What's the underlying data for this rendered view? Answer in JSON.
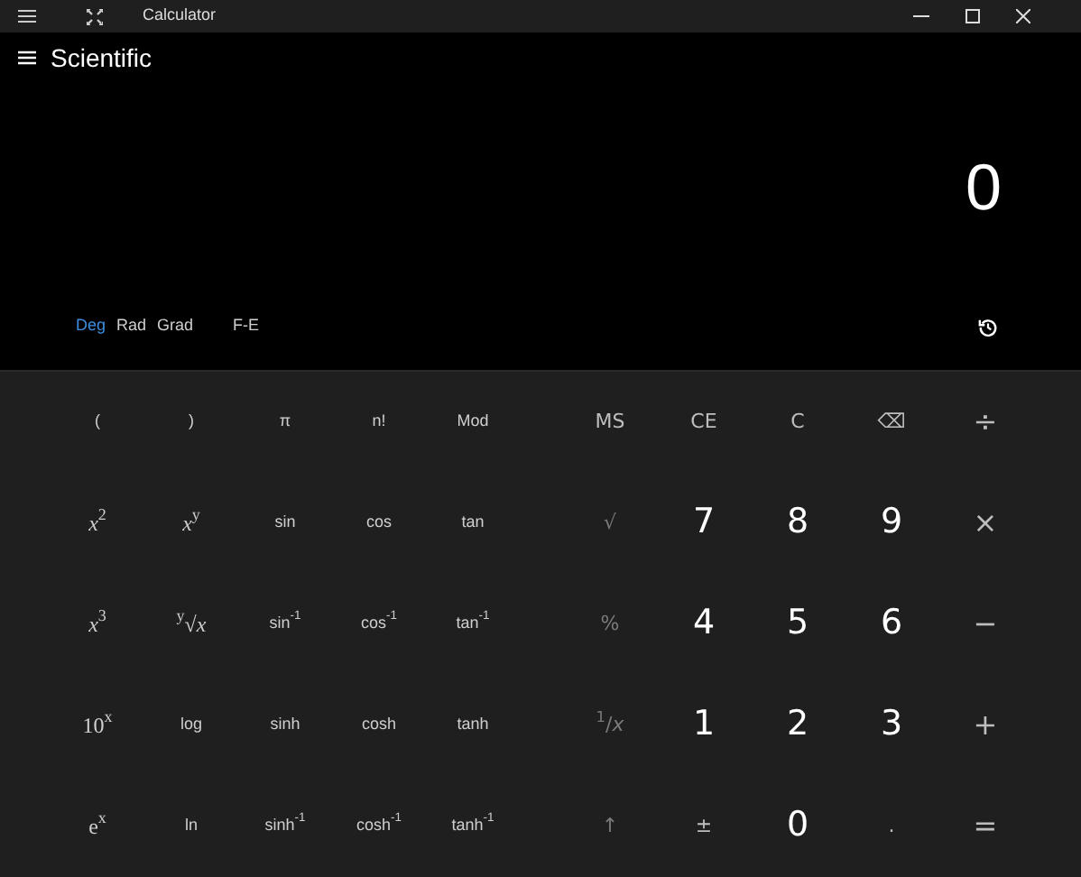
{
  "window": {
    "title": "Calculator"
  },
  "header": {
    "title": "Scientific"
  },
  "display": {
    "value": "0"
  },
  "angle_modes": [
    {
      "label": "Deg",
      "selected": true
    },
    {
      "label": "Rad",
      "selected": false
    },
    {
      "label": "Grad",
      "selected": false
    }
  ],
  "fe_toggle": {
    "label": "F-E",
    "on": false
  },
  "function_keys": [
    {
      "label": "("
    },
    {
      "label": ")"
    },
    {
      "label": "π"
    },
    {
      "label": "n!"
    },
    {
      "label": "Mod"
    },
    {
      "label": "*x*$^{2}$",
      "kind": "math"
    },
    {
      "label": "*x*$^{y}$",
      "kind": "math"
    },
    {
      "label": "sin"
    },
    {
      "label": "cos"
    },
    {
      "label": "tan"
    },
    {
      "label": "*x*$^{3}$",
      "kind": "math"
    },
    {
      "label": "$^{y}$√*x*",
      "kind": "math"
    },
    {
      "label": "sin$^{-1}$"
    },
    {
      "label": "cos$^{-1}$"
    },
    {
      "label": "tan$^{-1}$"
    },
    {
      "label": "10$^{x}$",
      "kind": "math"
    },
    {
      "label": "log"
    },
    {
      "label": "sinh"
    },
    {
      "label": "cosh"
    },
    {
      "label": "tanh"
    },
    {
      "label": "e$^{x}$",
      "kind": "math"
    },
    {
      "label": "ln"
    },
    {
      "label": "sinh$^{-1}$"
    },
    {
      "label": "cosh$^{-1}$"
    },
    {
      "label": "tanh$^{-1}$"
    }
  ],
  "standard_keys": [
    {
      "label": "MS",
      "kind": "function"
    },
    {
      "label": "CE",
      "kind": "function"
    },
    {
      "label": "C",
      "kind": "function"
    },
    {
      "label": "⌫",
      "kind": "function"
    },
    {
      "label": "÷",
      "kind": "operator"
    },
    {
      "label": "√",
      "kind": "muted"
    },
    {
      "label": "7",
      "kind": "digit"
    },
    {
      "label": "8",
      "kind": "digit"
    },
    {
      "label": "9",
      "kind": "digit"
    },
    {
      "label": "×",
      "kind": "operator"
    },
    {
      "label": "%",
      "kind": "muted"
    },
    {
      "label": "4",
      "kind": "digit"
    },
    {
      "label": "5",
      "kind": "digit"
    },
    {
      "label": "6",
      "kind": "digit"
    },
    {
      "label": "−",
      "kind": "operator"
    },
    {
      "label": "$^{1}$/*x*",
      "kind": "muted"
    },
    {
      "label": "1",
      "kind": "digit"
    },
    {
      "label": "2",
      "kind": "digit"
    },
    {
      "label": "3",
      "kind": "digit"
    },
    {
      "label": "+",
      "kind": "operator"
    },
    {
      "label": "↑",
      "kind": "muted"
    },
    {
      "label": "±",
      "kind": "function"
    },
    {
      "label": "0",
      "kind": "digit"
    },
    {
      "label": ".",
      "kind": "function"
    },
    {
      "label": "=",
      "kind": "operator"
    }
  ]
}
